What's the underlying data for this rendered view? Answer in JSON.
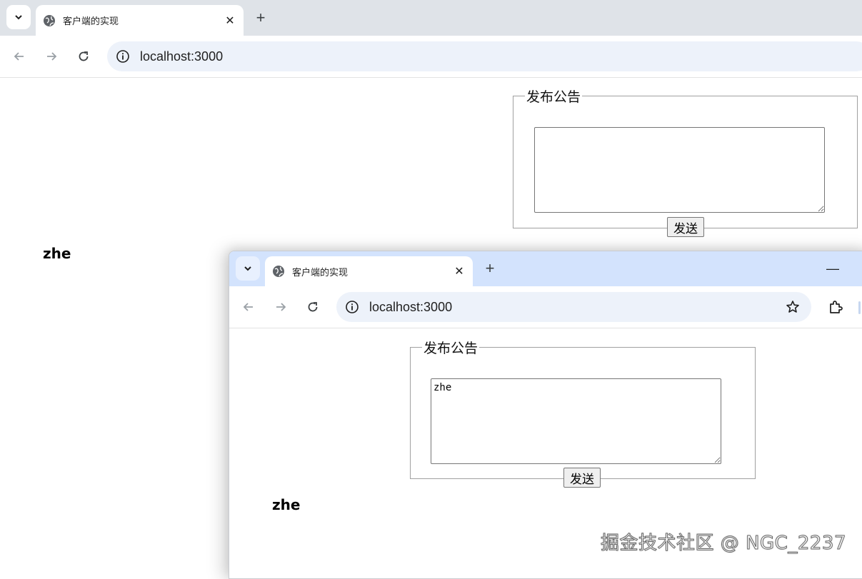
{
  "back_window": {
    "tab": {
      "title": "客户端的实现",
      "close": "✕"
    },
    "new_tab": "+",
    "address": "localhost:3000",
    "notice": {
      "legend": "发布公告",
      "textarea_value": "",
      "send_label": "发送"
    },
    "message": "zhe"
  },
  "front_window": {
    "tab": {
      "title": "客户端的实现",
      "close": "✕"
    },
    "new_tab": "+",
    "minimize": "—",
    "address": "localhost:3000",
    "notice": {
      "legend": "发布公告",
      "textarea_value": "zhe",
      "send_label": "发送"
    },
    "message": "zhe"
  },
  "watermark": "掘金技术社区 @ NGC_2237",
  "colors": {
    "tabstrip_back": "#dfe3e8",
    "tabstrip_front": "#d3e3fd",
    "omnibox": "#edf2fa"
  }
}
